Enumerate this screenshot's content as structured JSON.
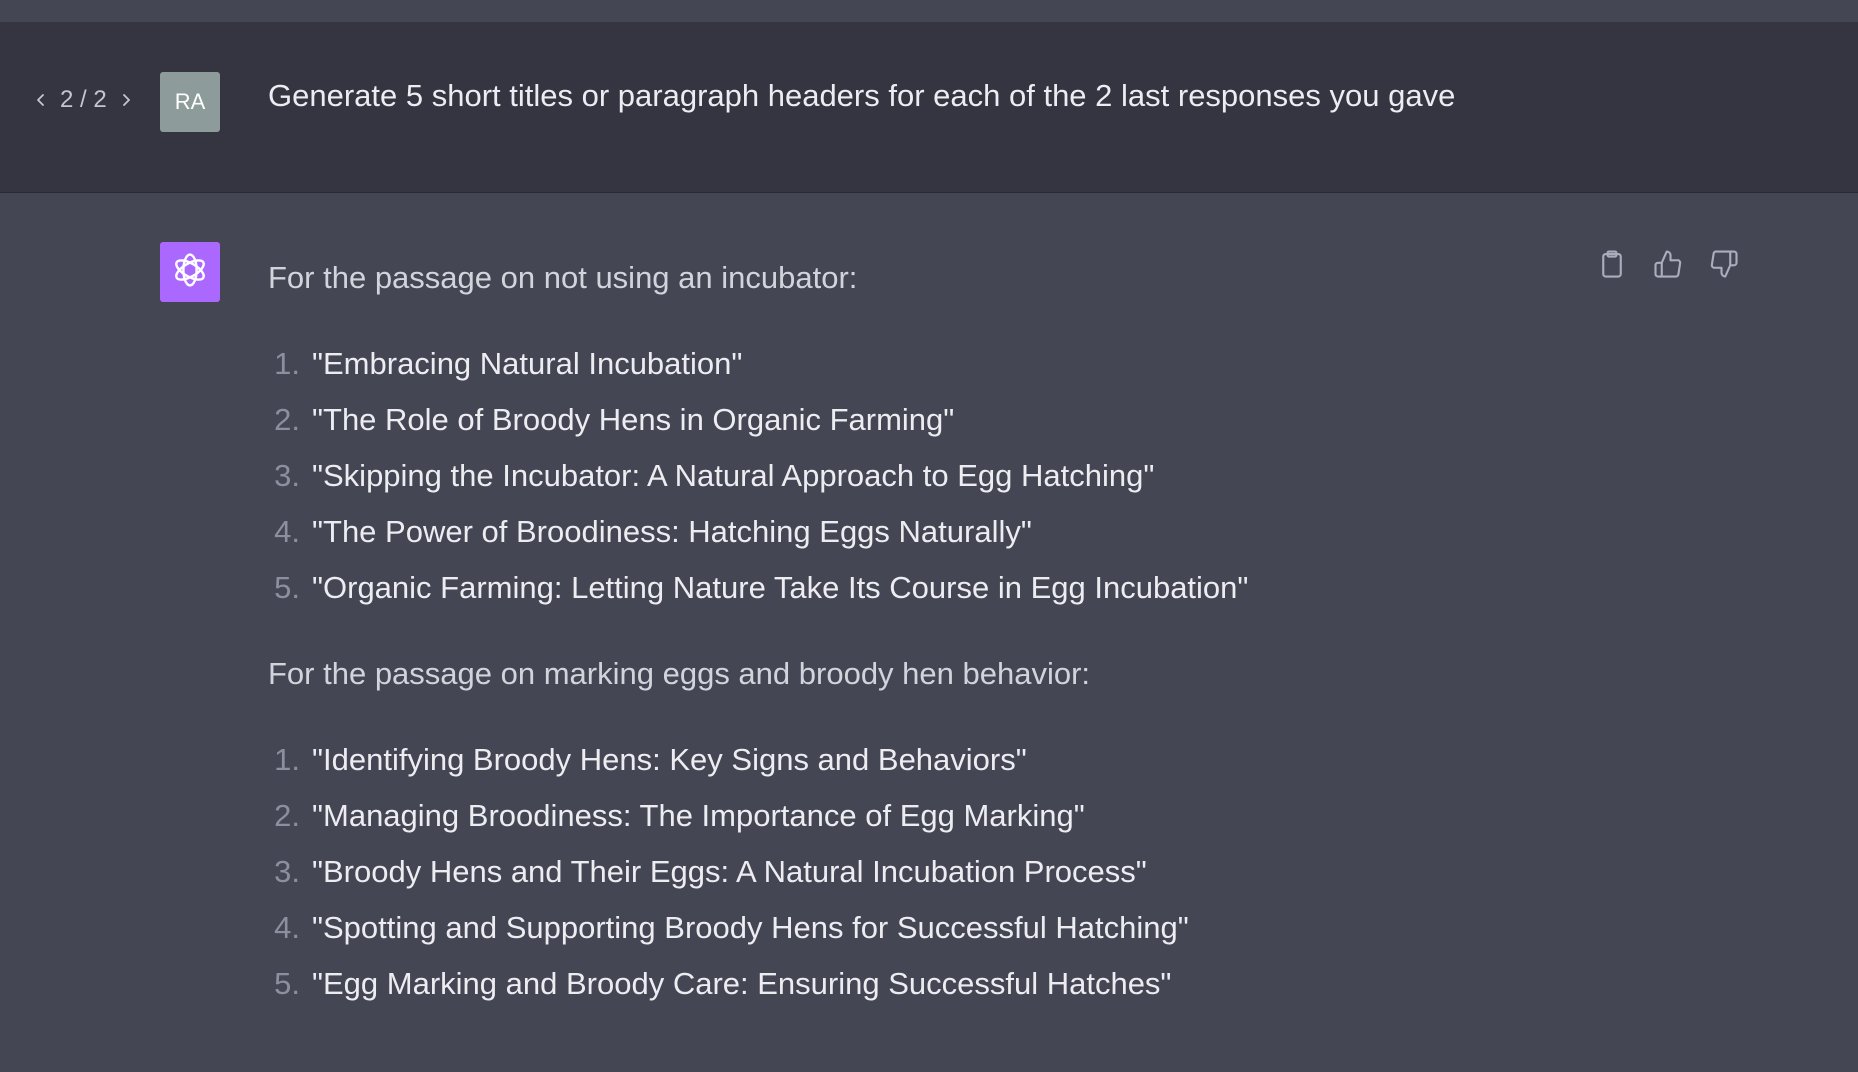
{
  "user_turn": {
    "pager": {
      "current_total": "2 / 2"
    },
    "avatar_initials": "RA",
    "message": "Generate 5 short titles or paragraph headers for each of the 2 last responses you gave"
  },
  "assistant_turn": {
    "avatar_icon": "openai-logo-icon",
    "actions": {
      "copy_icon": "clipboard-icon",
      "like_icon": "thumbs-up-icon",
      "dislike_icon": "thumbs-down-icon"
    },
    "intro_1": "For the passage on not using an incubator:",
    "list_1": [
      {
        "num": "1.",
        "text": "\"Embracing Natural Incubation\""
      },
      {
        "num": "2.",
        "text": "\"The Role of Broody Hens in Organic Farming\""
      },
      {
        "num": "3.",
        "text": "\"Skipping the Incubator: A Natural Approach to Egg Hatching\""
      },
      {
        "num": "4.",
        "text": "\"The Power of Broodiness: Hatching Eggs Naturally\""
      },
      {
        "num": "5.",
        "text": "\"Organic Farming: Letting Nature Take Its Course in Egg Incubation\""
      }
    ],
    "intro_2": "For the passage on marking eggs and broody hen behavior:",
    "list_2": [
      {
        "num": "1.",
        "text": "\"Identifying Broody Hens: Key Signs and Behaviors\""
      },
      {
        "num": "2.",
        "text": "\"Managing Broodiness: The Importance of Egg Marking\""
      },
      {
        "num": "3.",
        "text": "\"Broody Hens and Their Eggs: A Natural Incubation Process\""
      },
      {
        "num": "4.",
        "text": "\"Spotting and Supporting Broody Hens for Successful Hatching\""
      },
      {
        "num": "5.",
        "text": "\"Egg Marking and Broody Care: Ensuring Successful Hatches\""
      }
    ]
  },
  "colors": {
    "page_bg": "#444654",
    "user_row_bg": "#343541",
    "assistant_avatar_bg": "#ab68ff",
    "user_avatar_bg": "#8e9b9b"
  }
}
